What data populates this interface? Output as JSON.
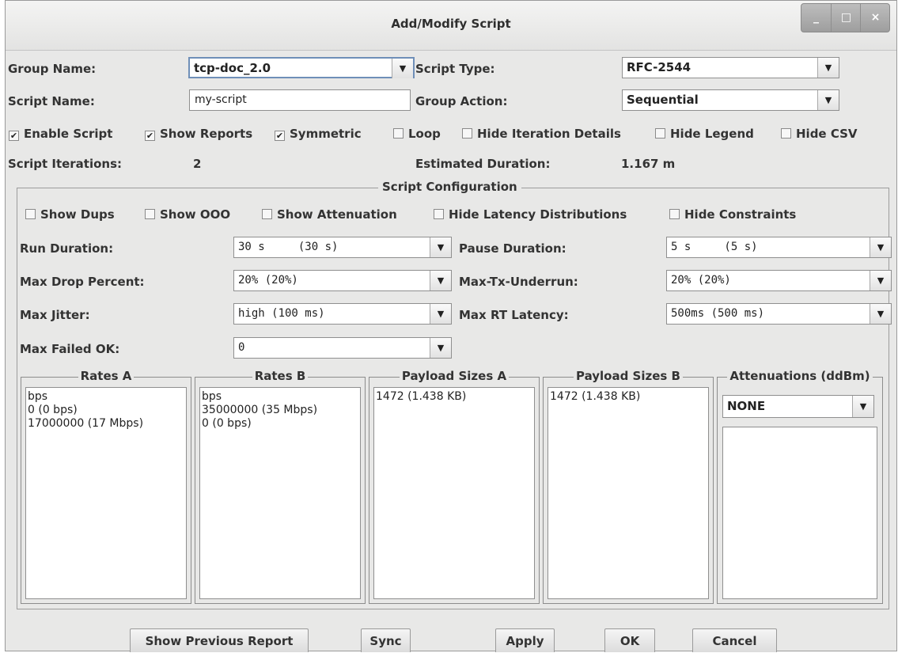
{
  "window": {
    "title": "Add/Modify Script",
    "controls": {
      "minimize": "_",
      "maximize": "□",
      "close": "×"
    }
  },
  "header": {
    "group_name_label": "Group Name:",
    "group_name_value": "tcp-doc_2.0",
    "script_type_label": "Script Type:",
    "script_type_value": "RFC-2544",
    "script_name_label": "Script Name:",
    "script_name_value": "my-script",
    "group_action_label": "Group Action:",
    "group_action_value": "Sequential",
    "script_iterations_label": "Script Iterations:",
    "script_iterations_value": "2",
    "estimated_duration_label": "Estimated Duration:",
    "estimated_duration_value": "1.167 m"
  },
  "options": [
    {
      "label": "Enable Script",
      "checked": true
    },
    {
      "label": "Show Reports",
      "checked": true
    },
    {
      "label": "Symmetric",
      "checked": true
    },
    {
      "label": "Loop",
      "checked": false
    },
    {
      "label": "Hide Iteration Details",
      "checked": false
    },
    {
      "label": "Hide Legend",
      "checked": false
    },
    {
      "label": "Hide CSV",
      "checked": false
    }
  ],
  "config": {
    "title": "Script Configuration",
    "options": [
      {
        "label": "Show Dups",
        "checked": false
      },
      {
        "label": "Show OOO",
        "checked": false
      },
      {
        "label": "Show Attenuation",
        "checked": false
      },
      {
        "label": "Hide Latency Distributions",
        "checked": false
      },
      {
        "label": "Hide Constraints",
        "checked": false
      }
    ],
    "run_duration_label": "Run Duration:",
    "run_duration_value": "30 s     (30 s)",
    "pause_duration_label": "Pause Duration:",
    "pause_duration_value": "5 s     (5 s)",
    "max_drop_label": "Max Drop Percent:",
    "max_drop_value": "20% (20%)",
    "max_tx_label": "Max-Tx-Underrun:",
    "max_tx_value": "20% (20%)",
    "max_jitter_label": "Max Jitter:",
    "max_jitter_value": "high (100 ms)",
    "max_rt_label": "Max RT Latency:",
    "max_rt_value": "500ms (500 ms)",
    "max_failed_label": "Max Failed OK:",
    "max_failed_value": "0",
    "rates_a": {
      "title": "Rates A",
      "items": [
        "bps",
        "0 (0 bps)",
        "17000000 (17 Mbps)"
      ]
    },
    "rates_b": {
      "title": "Rates B",
      "items": [
        "bps",
        "35000000 (35 Mbps)",
        "0 (0 bps)"
      ]
    },
    "payload_a": {
      "title": "Payload Sizes A",
      "items": [
        "1472 (1.438 KB)"
      ]
    },
    "payload_b": {
      "title": "Payload Sizes B",
      "items": [
        "1472 (1.438 KB)"
      ]
    },
    "attenuations": {
      "title": "Attenuations (ddBm)",
      "value": "NONE"
    }
  },
  "buttons": {
    "show_previous_report": "Show Previous Report",
    "sync": "Sync",
    "apply": "Apply",
    "ok": "OK",
    "cancel": "Cancel"
  },
  "icons": {
    "dropdown": "chevron-down-icon",
    "check": "checkmark-icon"
  }
}
